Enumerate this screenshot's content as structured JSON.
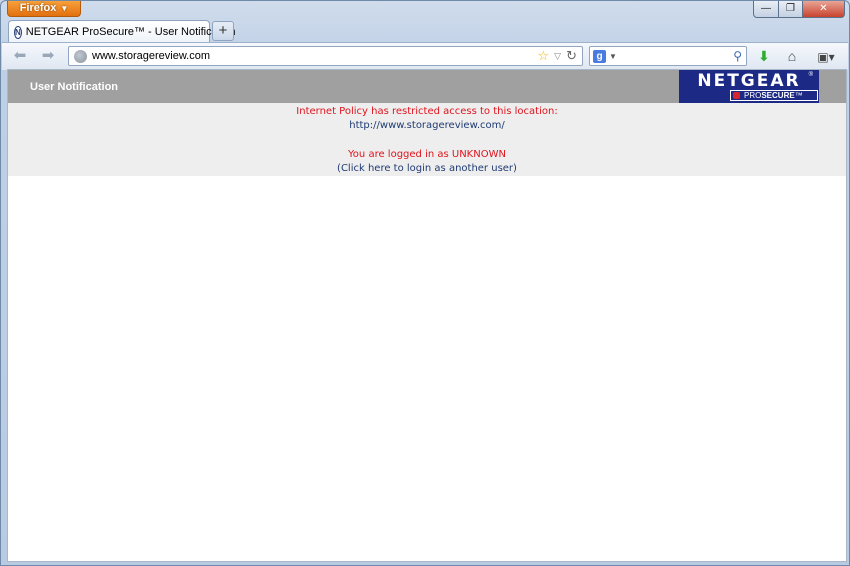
{
  "app": {
    "menu_button": "Firefox"
  },
  "window_controls": {
    "minimize": "—",
    "maximize": "❐",
    "close": "✕"
  },
  "tab": {
    "title": "NETGEAR ProSecure™ - User Notification",
    "favicon": "N",
    "new_tab_label": "+"
  },
  "nav": {
    "back_icon": "back-arrow-icon",
    "forward_icon": "forward-arrow-icon",
    "url": "www.storagereview.com",
    "search_engine": "g",
    "search_value": ""
  },
  "page": {
    "header_title": "User Notification",
    "logo": {
      "word": "NETGEAR",
      "reg": "®",
      "sub_pro": "PRO",
      "sub_secure": "SECURE",
      "sub_tm": "™"
    },
    "policy_message": "Internet Policy has restricted access to this location:",
    "blocked_url": "http://www.storagereview.com/",
    "login_status": "You are logged in as UNKNOWN",
    "login_link": "(Click here to login as another user)"
  },
  "colors": {
    "header_bg": "#a0a0a0",
    "body_bg": "#eeeeee",
    "logo_bg": "#1c2a86",
    "alert_red": "#e0141e",
    "link_blue": "#1f3b73",
    "firefox_orange": "#e2700f"
  }
}
